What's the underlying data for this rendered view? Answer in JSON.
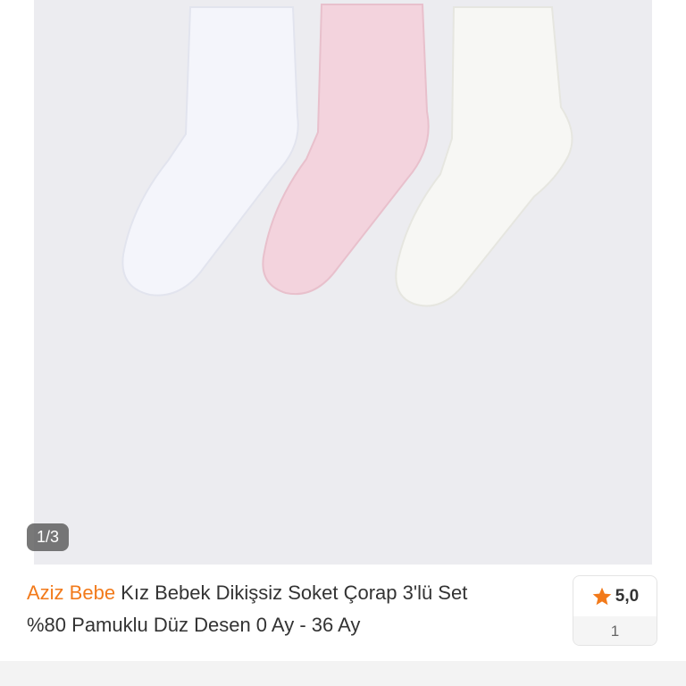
{
  "gallery": {
    "counter": "1/3",
    "photo_description_icon": "product-photo"
  },
  "product": {
    "brand": "Aziz Bebe",
    "name_line1": " Kız Bebek Dikişsiz Soket Çorap 3'lü Set",
    "name_line2": "%80 Pamuklu Düz Desen 0 Ay - 36 Ay"
  },
  "rating": {
    "icon": "star-icon",
    "value": "5,0",
    "count": "1"
  },
  "colors": {
    "brand": "#f27a1a",
    "star": "#f27a1a",
    "photo_bg": "#ececf0"
  }
}
